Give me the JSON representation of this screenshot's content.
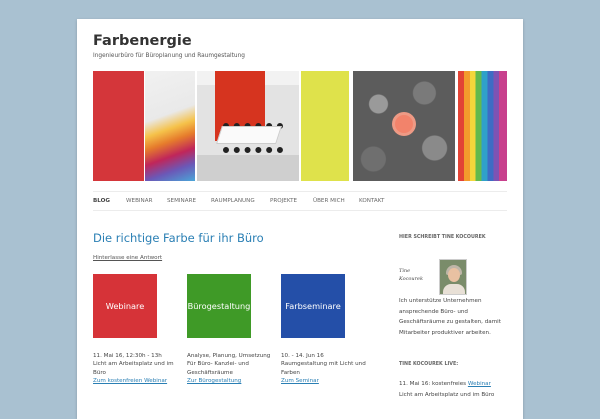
{
  "site": {
    "title": "Farbenergie",
    "tagline": "Ingenieurbüro für Büroplanung und Raumgestaltung"
  },
  "nav": {
    "items": [
      {
        "label": "BLOG"
      },
      {
        "label": "WEBINAR"
      },
      {
        "label": "SEMINARE"
      },
      {
        "label": "RAUMPLANUNG"
      },
      {
        "label": "PROJEKTE"
      },
      {
        "label": "ÜBER MICH"
      },
      {
        "label": "KONTAKT"
      }
    ]
  },
  "post": {
    "title": "Die richtige Farbe für ihr Büro",
    "reply_link": "Hinterlasse eine Antwort",
    "tiles": [
      {
        "label": "Webinare",
        "color": "#d63338"
      },
      {
        "label": "Bürogestaltung",
        "color": "#3f9a27"
      },
      {
        "label": "Farbseminare",
        "color": "#244fa8"
      }
    ],
    "columns": [
      {
        "line1": "11. Mai 16, 12:30h - 13h",
        "line2": "Licht am Arbeitsplatz und im",
        "line3": "Büro",
        "link": "Zum kostenfreien Webinar"
      },
      {
        "line1": "Analyse, Planung, Umsetzung",
        "line2": "Für Büro- Kanzlei- und",
        "line3": "Geschäftsräume",
        "link": "Zur Bürogestaltung"
      },
      {
        "line1": "10. - 14. Jun 16",
        "line2": "Raumgestaltung mit Licht und",
        "line3": "Farben",
        "link": "Zum Seminar"
      }
    ]
  },
  "sidebar": {
    "heading1": "HIER SCHREIBT TINE KOCOUREK",
    "signature_line1": "Tine",
    "signature_line2": "Kocourek",
    "about_lines": [
      "Ich unterstütze Unternehmen",
      "ansprechende Büro- und",
      "Geschäftsräume zu gestalten, damit",
      "Mitarbeiter produktiver arbeiten."
    ],
    "heading2": "TINE KOCOUREK LIVE:",
    "live_line1_prefix": "11. Mai 16: kostenfreies",
    "live_line1_link": "Webinar",
    "live_line2": "Licht am Arbeitsplatz und im Büro"
  }
}
